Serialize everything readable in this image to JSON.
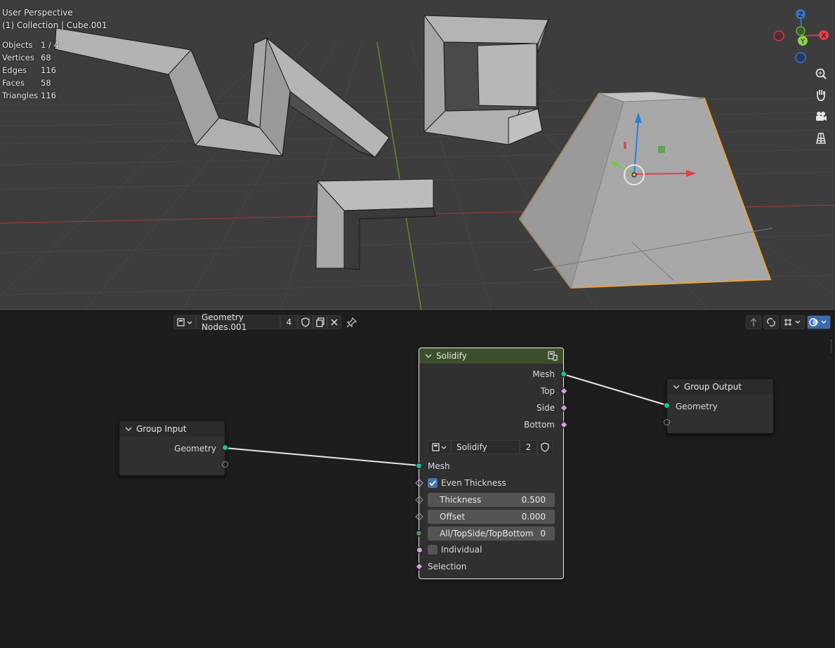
{
  "viewport": {
    "perspective": "User Perspective",
    "collection": "(1) Collection | Cube.001",
    "stats": [
      {
        "label": "Objects",
        "value": "1 / 4"
      },
      {
        "label": "Vertices",
        "value": "68"
      },
      {
        "label": "Edges",
        "value": "116"
      },
      {
        "label": "Faces",
        "value": "58"
      },
      {
        "label": "Triangles",
        "value": "116"
      }
    ],
    "gizmo": {
      "z": "Z",
      "y": "Y",
      "x": "X"
    },
    "nav_icons": [
      "zoom-icon",
      "hand-icon",
      "camera-icon",
      "grid-icon"
    ]
  },
  "editor": {
    "tree_name": "Geometry Nodes.001",
    "users": "4",
    "header_icons": [
      "node-tree-icon",
      "fake-user-shield-icon",
      "duplicate-icon",
      "close-icon",
      "pin-icon",
      "parent-arrow-icon",
      "link-icon",
      "snap-icon",
      "overlay-icon"
    ]
  },
  "nodes": {
    "group_input": {
      "title": "Group Input",
      "out_geometry": "Geometry"
    },
    "solidify": {
      "title": "Solidify",
      "outputs": [
        "Mesh",
        "Top",
        "Side",
        "Bottom"
      ],
      "subtree": "Solidify",
      "subtree_users": "2",
      "in_mesh": "Mesh",
      "even_thickness": "Even Thickness",
      "even_checked": true,
      "thickness_label": "Thickness",
      "thickness_value": "0.500",
      "offset_label": "Offset",
      "offset_value": "0.000",
      "mode_label": "All/TopSide/TopBottom",
      "mode_value": "0",
      "individual": "Individual",
      "individual_checked": false,
      "selection": "Selection"
    },
    "group_output": {
      "title": "Group Output",
      "in_geometry": "Geometry"
    }
  },
  "colors": {
    "selection_orange": "#e8a33c",
    "solidify_header": "#3c4f2c",
    "geometry_socket": "#16c49a",
    "bool_socket": "#cca6d6"
  }
}
